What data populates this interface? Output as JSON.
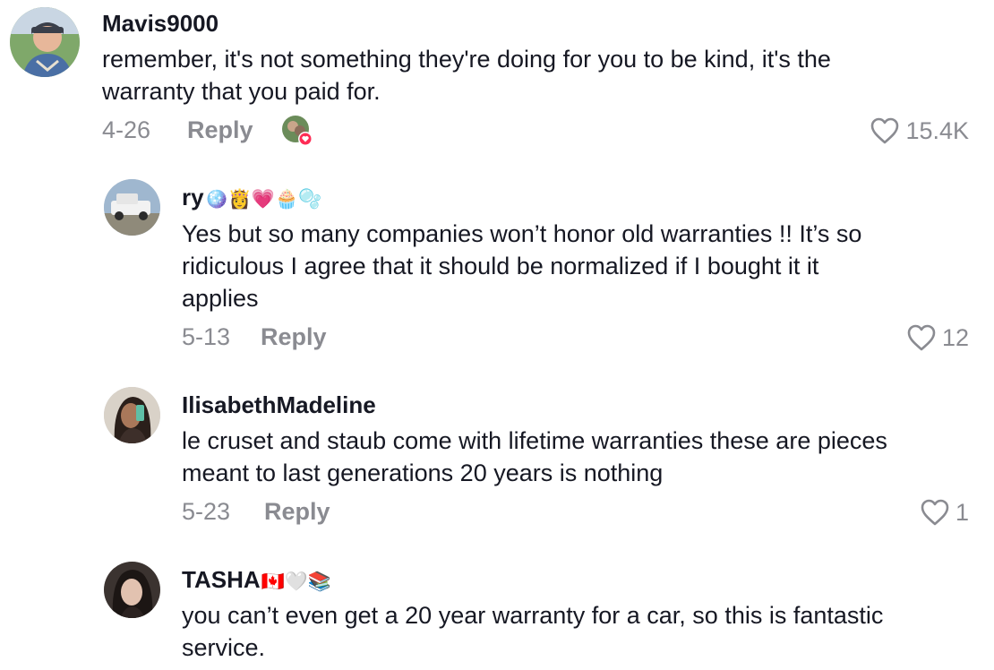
{
  "comments": [
    {
      "username": "Mavis9000",
      "username_emoji": "",
      "text": "remember, it's not something they're doing for you to be kind, it's the\nwarranty that you paid for.",
      "date": "4-26",
      "reply_label": "Reply",
      "likes": "15.4K"
    },
    {
      "username": "ry",
      "username_emoji": "🪩👸💗🧁🫧",
      "text": "Yes but so many companies won’t honor old warranties !! It’s so\nridiculous I agree that it should be normalized if I bought it it\napplies",
      "date": "5-13",
      "reply_label": "Reply",
      "likes": "12"
    },
    {
      "username": "IlisabethMadeline",
      "username_emoji": "",
      "text": "le cruset and staub come with lifetime warranties these are pieces\nmeant to last generations 20 years is nothing",
      "date": "5-23",
      "reply_label": "Reply",
      "likes": "1"
    },
    {
      "username": "TASHA",
      "username_emoji": "🇨🇦🤍📚",
      "text": "you can’t even get a 20 year warranty for a car, so this is fantastic\nservice."
    }
  ],
  "colors": {
    "primary_text": "#161823",
    "secondary_text": "#8a8b91",
    "heart_badge": "#fe2c55"
  },
  "icons": {
    "like": "heart-outline-icon",
    "creator_liked": "creator-liked-badge-icon"
  }
}
